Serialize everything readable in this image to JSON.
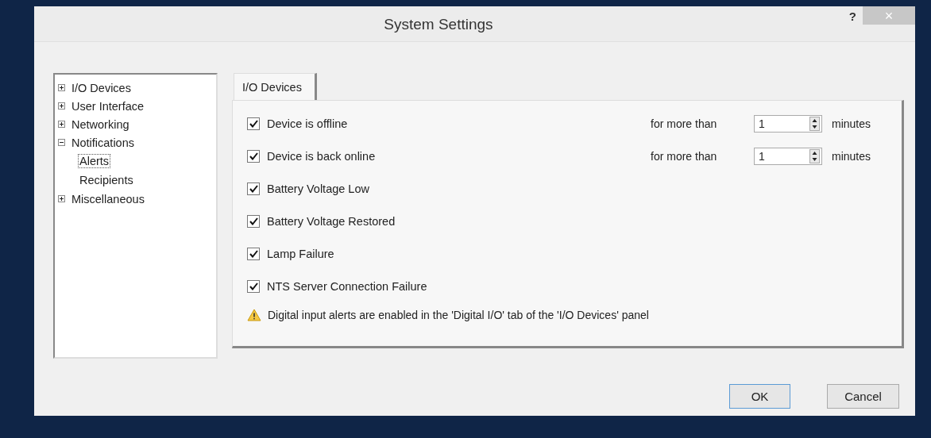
{
  "window": {
    "title": "System Settings",
    "help": "?",
    "close": "×"
  },
  "tree": [
    {
      "label": "I/O Devices",
      "expanded": false,
      "selected": false
    },
    {
      "label": "User Interface",
      "expanded": false,
      "selected": false
    },
    {
      "label": "Networking",
      "expanded": false,
      "selected": false
    },
    {
      "label": "Notifications",
      "expanded": true,
      "selected": false,
      "children": [
        {
          "label": "Alerts",
          "selected": true
        },
        {
          "label": "Recipients",
          "selected": false
        }
      ]
    },
    {
      "label": "Miscellaneous",
      "expanded": false,
      "selected": false
    }
  ],
  "tabs": [
    {
      "label": "I/O Devices",
      "selected": true
    }
  ],
  "alerts": [
    {
      "label": "Device is offline",
      "checked": true,
      "prefix": "for more than",
      "value": "1",
      "unit": "minutes"
    },
    {
      "label": "Device is back online",
      "checked": true,
      "prefix": "for more than",
      "value": "1",
      "unit": "minutes"
    },
    {
      "label": "Battery Voltage Low",
      "checked": true
    },
    {
      "label": "Battery Voltage Restored",
      "checked": true
    },
    {
      "label": "Lamp Failure",
      "checked": true
    },
    {
      "label": "NTS Server Connection Failure",
      "checked": true
    }
  ],
  "note": "Digital input alerts are enabled in the 'Digital I/O' tab of the 'I/O Devices' panel",
  "buttons": [
    {
      "label": "OK",
      "default": true
    },
    {
      "label": "Cancel",
      "default": false
    }
  ]
}
